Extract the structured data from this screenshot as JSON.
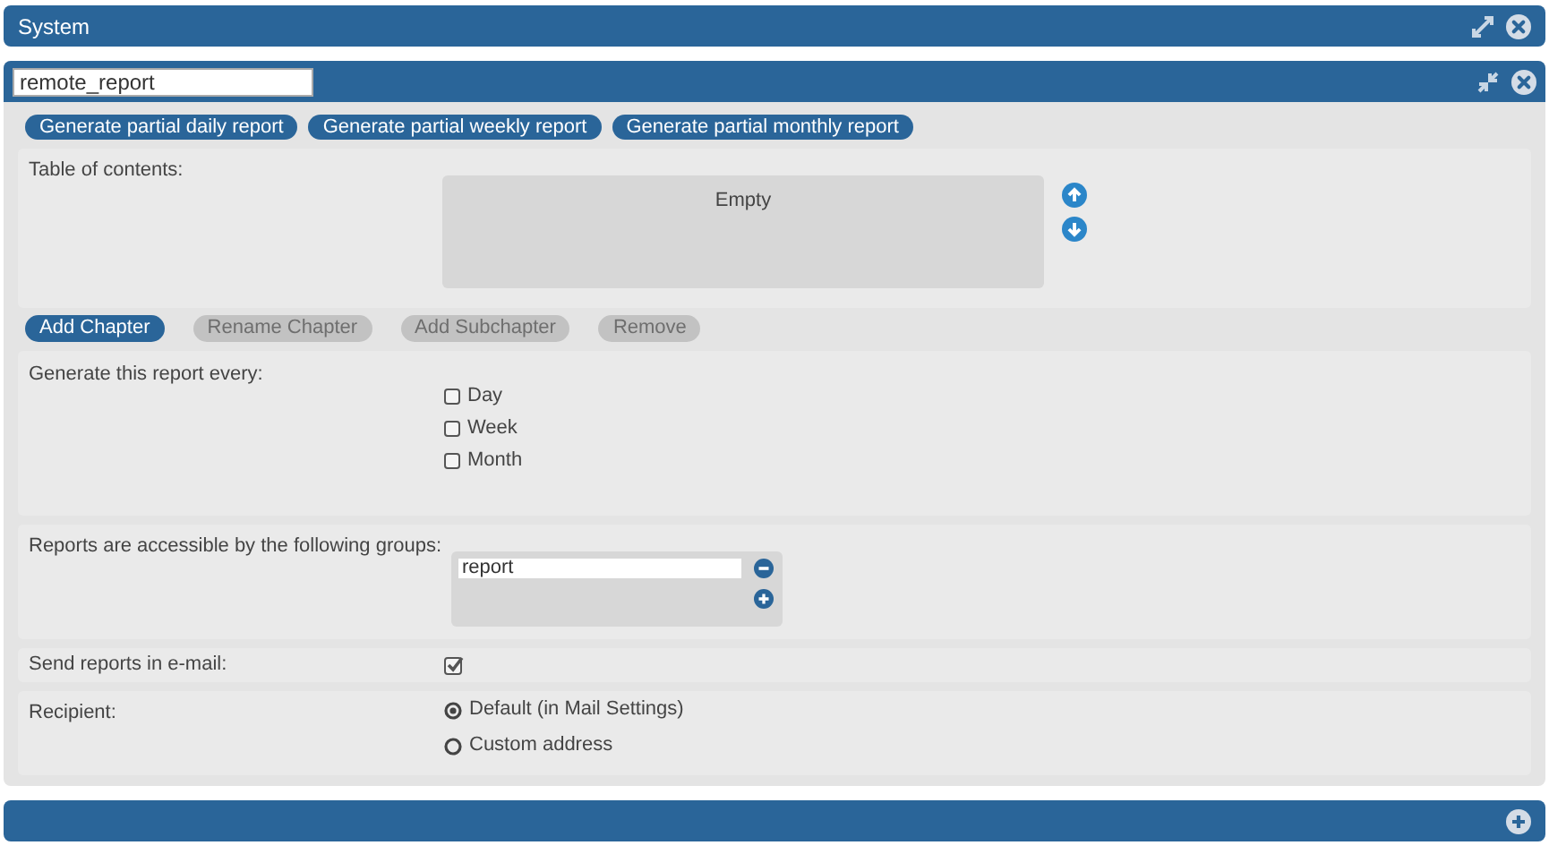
{
  "system_bar": {
    "title": "System"
  },
  "report": {
    "name": "remote_report",
    "generate_buttons": [
      "Generate partial daily report",
      "Generate partial weekly report",
      "Generate partial monthly report"
    ],
    "toc": {
      "label": "Table of contents:",
      "empty_text": "Empty"
    },
    "chapter_buttons": [
      {
        "label": "Add Chapter",
        "disabled": false
      },
      {
        "label": "Rename Chapter",
        "disabled": true
      },
      {
        "label": "Add Subchapter",
        "disabled": true
      },
      {
        "label": "Remove",
        "disabled": true
      }
    ],
    "schedule": {
      "label": "Generate this report every:",
      "options": [
        {
          "label": "Day",
          "checked": false
        },
        {
          "label": "Week",
          "checked": false
        },
        {
          "label": "Month",
          "checked": false
        }
      ]
    },
    "groups": {
      "label": "Reports are accessible by the following groups:",
      "items": [
        "report"
      ]
    },
    "email": {
      "label": "Send reports in e-mail:",
      "checked": true
    },
    "recipient": {
      "label": "Recipient:",
      "options": [
        {
          "label": "Default (in Mail Settings)",
          "selected": true
        },
        {
          "label": "Custom address",
          "selected": false
        }
      ]
    }
  }
}
